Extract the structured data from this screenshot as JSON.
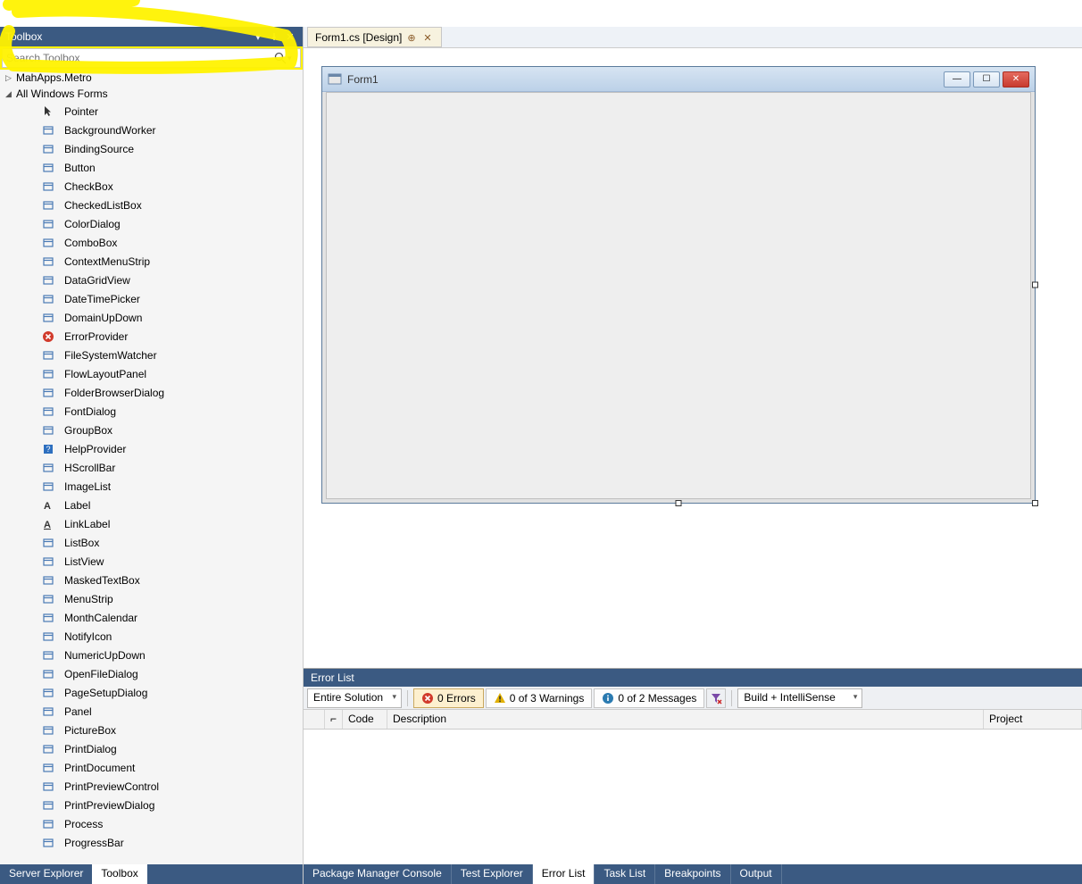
{
  "toolbox": {
    "title": "Toolbox",
    "search_placeholder": "Search Toolbox",
    "categories": [
      {
        "name": "MahApps.Metro",
        "expanded": false
      },
      {
        "name": "All Windows Forms",
        "expanded": true
      }
    ],
    "items": [
      "Pointer",
      "BackgroundWorker",
      "BindingSource",
      "Button",
      "CheckBox",
      "CheckedListBox",
      "ColorDialog",
      "ComboBox",
      "ContextMenuStrip",
      "DataGridView",
      "DateTimePicker",
      "DomainUpDown",
      "ErrorProvider",
      "FileSystemWatcher",
      "FlowLayoutPanel",
      "FolderBrowserDialog",
      "FontDialog",
      "GroupBox",
      "HelpProvider",
      "HScrollBar",
      "ImageList",
      "Label",
      "LinkLabel",
      "ListBox",
      "ListView",
      "MaskedTextBox",
      "MenuStrip",
      "MonthCalendar",
      "NotifyIcon",
      "NumericUpDown",
      "OpenFileDialog",
      "PageSetupDialog",
      "Panel",
      "PictureBox",
      "PrintDialog",
      "PrintDocument",
      "PrintPreviewControl",
      "PrintPreviewDialog",
      "Process",
      "ProgressBar"
    ]
  },
  "left_tabs": {
    "items": [
      "Server Explorer",
      "Toolbox"
    ],
    "active": "Toolbox"
  },
  "doc_tab": {
    "label": "Form1.cs [Design]"
  },
  "form": {
    "title": "Form1"
  },
  "error_panel": {
    "title": "Error List",
    "scope": "Entire Solution",
    "errors": "0 Errors",
    "warnings": "0 of 3 Warnings",
    "messages": "0 of 2 Messages",
    "build_filter": "Build + IntelliSense",
    "cols": {
      "code": "Code",
      "description": "Description",
      "project": "Project"
    }
  },
  "right_tabs": {
    "items": [
      "Package Manager Console",
      "Test Explorer",
      "Error List",
      "Task List",
      "Breakpoints",
      "Output"
    ],
    "active": "Error List"
  }
}
